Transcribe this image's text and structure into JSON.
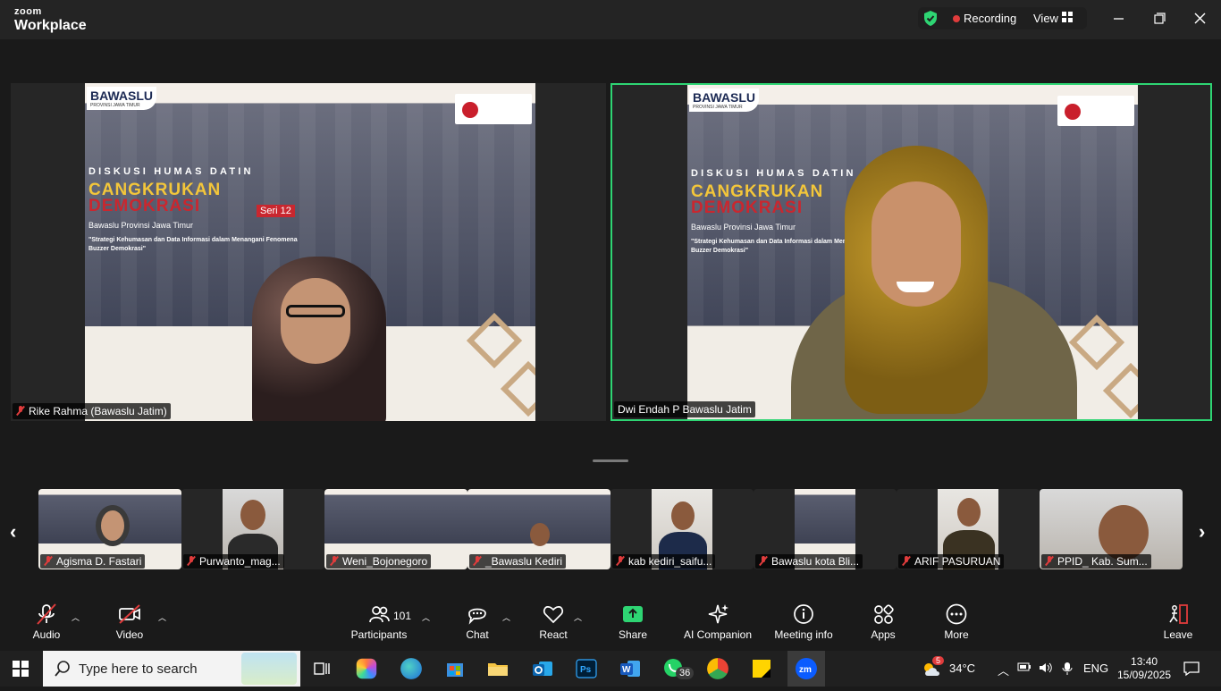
{
  "app": {
    "brand_top": "zoom",
    "brand_bottom": "Workplace"
  },
  "header": {
    "recording_label": "Recording",
    "view_label": "View"
  },
  "slide": {
    "org": "BAWASLU",
    "org_sub": "PROVINSI JAWA TIMUR",
    "kicker": "DISKUSI HUMAS DATIN",
    "title1": "CANGKRUKAN",
    "title2": "DEMOKRASI",
    "series": "Seri 12",
    "subtitle": "Bawaslu Provinsi Jawa Timur",
    "topic": "\"Strategi Kehumasan dan Data Informasi dalam Menangani Fenomena Buzzer Demokrasi\""
  },
  "speakers": [
    {
      "name": "Rike Rahma (Bawaslu Jatim)",
      "muted": true
    },
    {
      "name": "Dwi Endah P Bawaslu Jatim",
      "muted": false,
      "active": true
    }
  ],
  "gallery": [
    {
      "name": "Agisma D. Fastari",
      "muted": true
    },
    {
      "name": "Purwanto_mag...",
      "muted": true
    },
    {
      "name": "Weni_Bojonegoro",
      "muted": true
    },
    {
      "name": "_Bawaslu Kediri",
      "muted": true
    },
    {
      "name": "kab kediri_saifu...",
      "muted": true
    },
    {
      "name": "Bawaslu kota Bli...",
      "muted": true
    },
    {
      "name": "ARIF PASURUAN",
      "muted": true
    },
    {
      "name": "PPID_ Kab. Sum...",
      "muted": true
    }
  ],
  "toolbar": {
    "audio": "Audio",
    "video": "Video",
    "participants": "Participants",
    "participants_count": "101",
    "chat": "Chat",
    "react": "React",
    "share": "Share",
    "ai": "AI Companion",
    "meeting_info": "Meeting info",
    "apps": "Apps",
    "more": "More",
    "leave": "Leave"
  },
  "taskbar": {
    "search_placeholder": "Type here to search",
    "whatsapp_badge": "36",
    "weather_badge": "5",
    "temperature": "34°C",
    "language": "ENG",
    "time": "13:40",
    "date": "15/09/2025"
  },
  "colors": {
    "active_speaker": "#2ed573",
    "share_green": "#2ed573",
    "record_red": "#e03c3c"
  }
}
